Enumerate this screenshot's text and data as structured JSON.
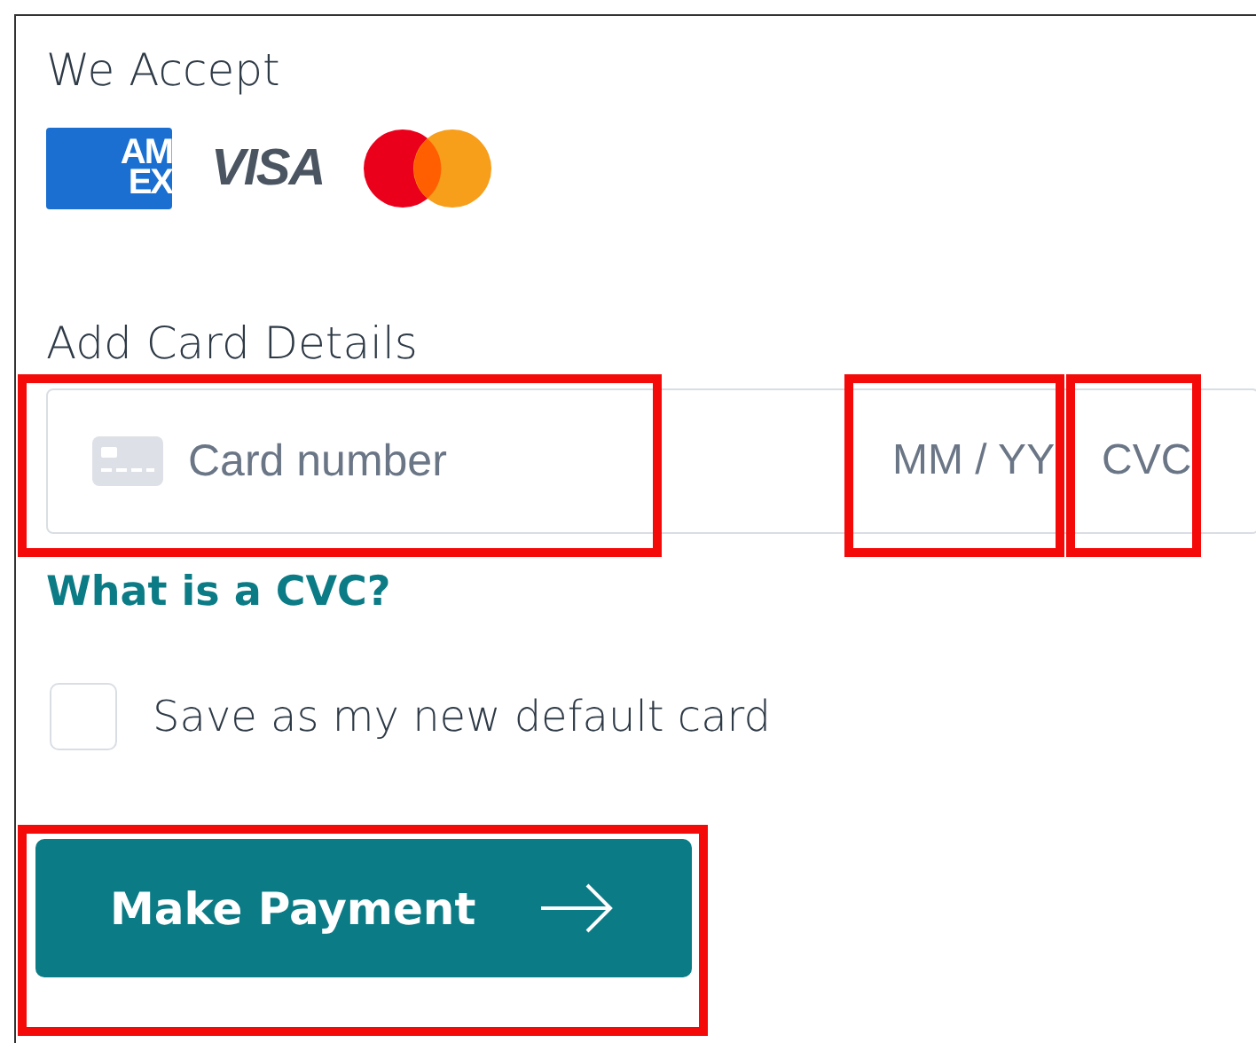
{
  "accept_heading": "We Accept",
  "card_logos": [
    {
      "kind": "amex",
      "lines": [
        "AM",
        "EX"
      ]
    },
    {
      "kind": "visa",
      "lines": [
        "VISA"
      ]
    },
    {
      "kind": "mastercard"
    }
  ],
  "details_heading": "Add Card Details",
  "card_fields": [
    {
      "kind": "number",
      "placeholder": "Card number"
    },
    {
      "kind": "expiry",
      "placeholder": "MM / YY"
    },
    {
      "kind": "cvc",
      "placeholder": "CVC"
    }
  ],
  "cvc_link": "What is a CVC?",
  "default_card": {
    "label": "Save as my new default card",
    "checked": false
  },
  "pay_button": {
    "label": "Make Payment"
  }
}
